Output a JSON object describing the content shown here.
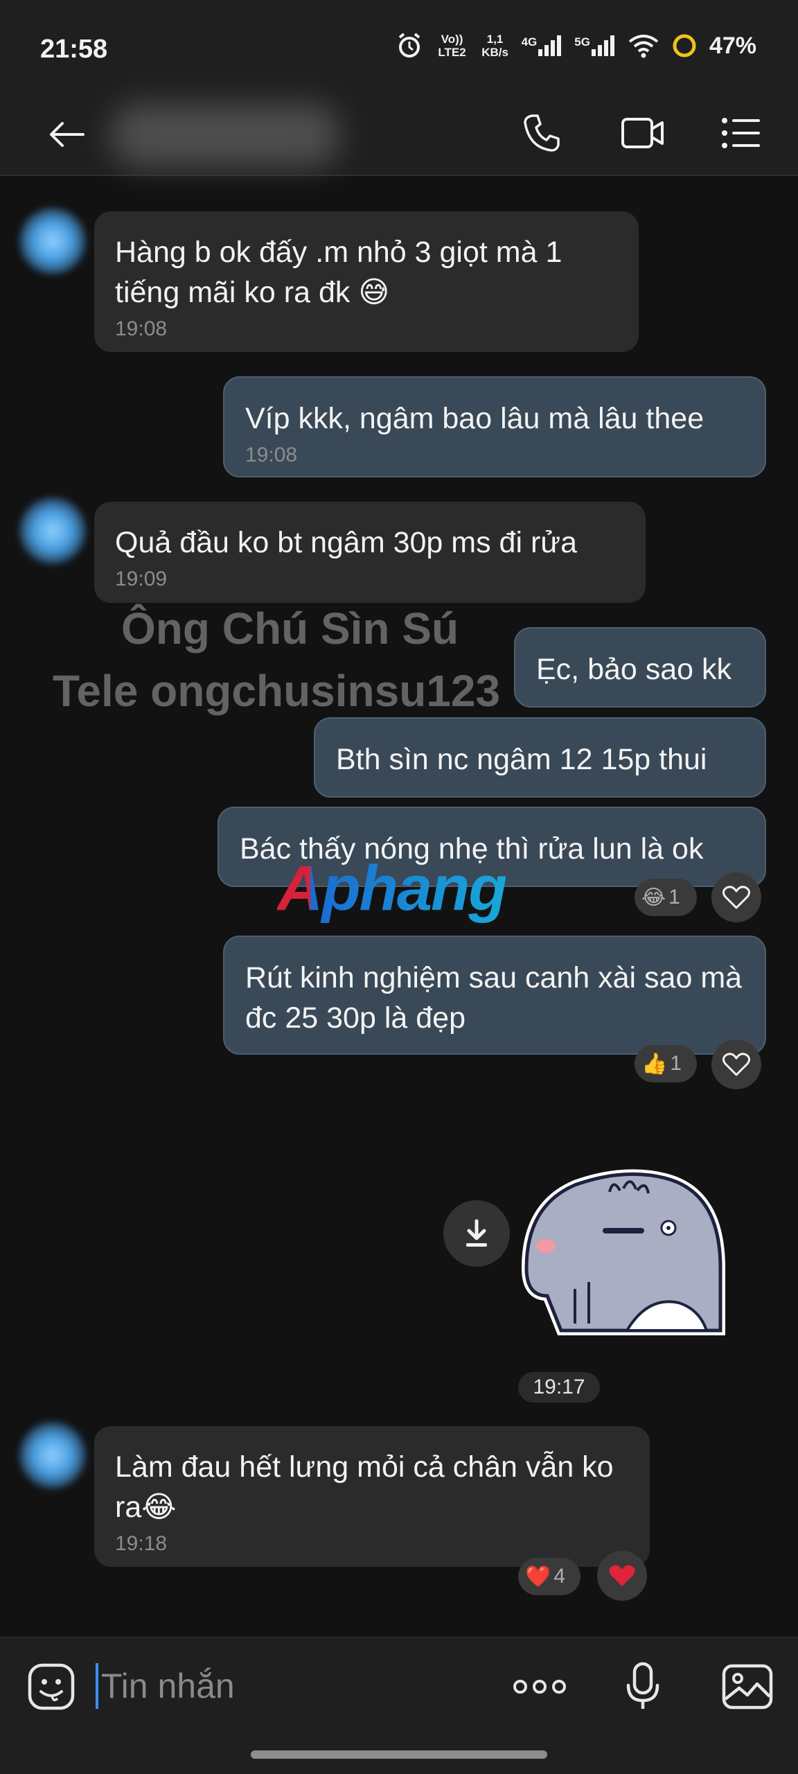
{
  "status_bar": {
    "time": "21:58",
    "volte": "Vo)) LTE2",
    "net_speed_value": "1,1",
    "net_speed_unit": "KB/s",
    "net_4g": "4G",
    "net_5g": "5G",
    "battery": "47%"
  },
  "header": {
    "back_icon": "arrow-left-icon",
    "call_icon": "phone-icon",
    "video_icon": "video-camera-icon",
    "menu_icon": "list-menu-icon"
  },
  "messages": [
    {
      "dir": "in",
      "text": "Hàng b ok đấy .m nhỏ 3 giọt mà 1 tiếng mãi ko ra đk 😅",
      "time": "19:08"
    },
    {
      "dir": "out",
      "text": "Víp kkk, ngâm bao lâu mà lâu thee",
      "time": "19:08"
    },
    {
      "dir": "in",
      "text": "Quả đầu ko bt ngâm 30p ms đi rửa",
      "time": "19:09"
    },
    {
      "dir": "out",
      "text": "Ẹc, bảo sao kk"
    },
    {
      "dir": "out",
      "text": "Bth sìn nc ngâm 12 15p thui"
    },
    {
      "dir": "out",
      "text": "Bác thấy nóng nhẹ thì rửa lun là ok",
      "reaction_emoji": "😂",
      "reaction_count": "1"
    },
    {
      "dir": "out",
      "text": "Rút kinh nghiệm sau canh xài sao mà đc 25 30p là đẹp",
      "reaction_emoji": "👍",
      "reaction_count": "1"
    },
    {
      "dir": "in",
      "text": "Làm đau hết lưng mỏi cả chân vẫn ko ra😂",
      "time": "19:18",
      "reaction_emoji": "❤️",
      "reaction_count": "4"
    }
  ],
  "sticker": {
    "time": "19:17"
  },
  "watermark": {
    "line1": "Ông Chú Sìn Sú",
    "line2": "Tele ongchusinsu123",
    "logo": "Aphang"
  },
  "composer": {
    "placeholder": "Tin nhắn",
    "emoji_icon": "sticker-face-icon",
    "more_icon": "more-dots-icon",
    "mic_icon": "microphone-icon",
    "image_icon": "image-gallery-icon"
  },
  "colors": {
    "background": "#121212",
    "bubble_in": "#2b2b2b",
    "bubble_out": "#394958",
    "accent": "#3d8ef0",
    "heart": "#e0243a"
  }
}
